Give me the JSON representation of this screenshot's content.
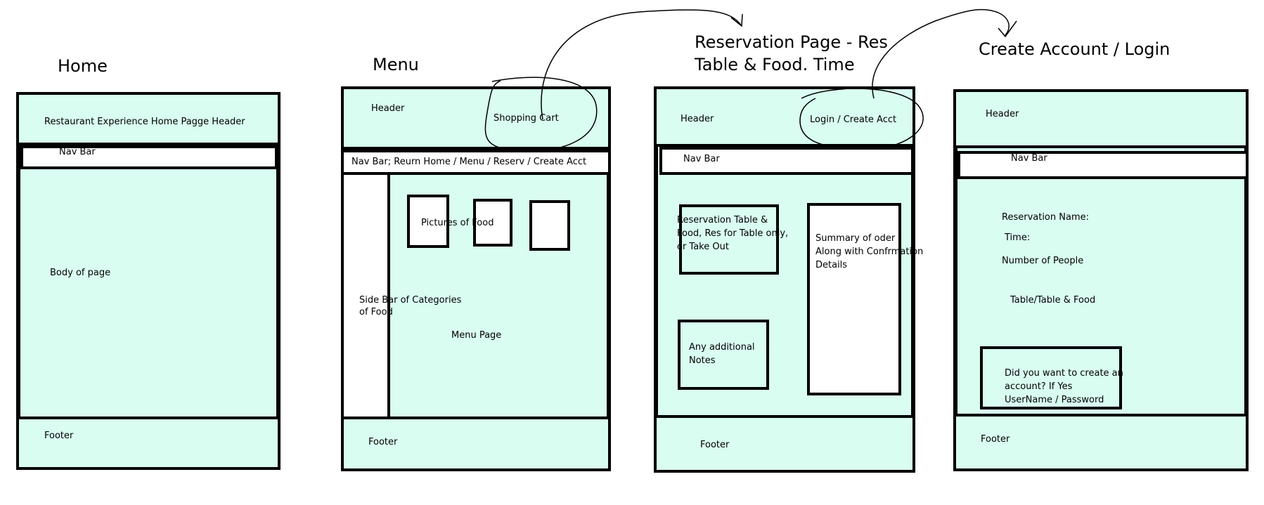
{
  "home": {
    "title": "Home",
    "header": "Restaurant Experience Home Pagge Header",
    "nav": "Nav Bar",
    "body": "Body of page",
    "footer": "Footer"
  },
  "menu": {
    "title": "Menu",
    "header": "Header",
    "cart": "Shopping Cart",
    "nav": "Nav Bar; Reurn Home / Menu / Reserv / Create Acct",
    "pictures": "Pictures of Food",
    "sidebar_line1": "Side Bar of Categories",
    "sidebar_line2": "of Food",
    "page": "Menu Page",
    "footer": "Footer"
  },
  "reservation": {
    "title_line1": "Reservation Page - Res",
    "title_line2": "Table & Food. Time",
    "header": "Header",
    "login": "Login / Create Acct",
    "nav": "Nav Bar",
    "res_line1": "Reservation Table &",
    "res_line2": "Food, Res for Table only,",
    "res_line3": "or Take Out",
    "summary_line1": "Summary of oder",
    "summary_line2": "Along with Confrmation",
    "summary_line3": "Details",
    "notes_line1": "Any additional",
    "notes_line2": "Notes",
    "footer": "Footer"
  },
  "account": {
    "title": "Create Account / Login",
    "header": "Header",
    "nav": "Nav Bar",
    "res_name": "Reservation Name:",
    "time": "Time:",
    "people": "Number of People",
    "table": "Table/Table & Food",
    "create_line1": "Did you want to create an",
    "create_line2": "account? If Yes",
    "create_line3": "UserName / Password",
    "footer": "Footer"
  },
  "colors": {
    "fill": "#d9fdf0",
    "stroke": "#000000"
  }
}
